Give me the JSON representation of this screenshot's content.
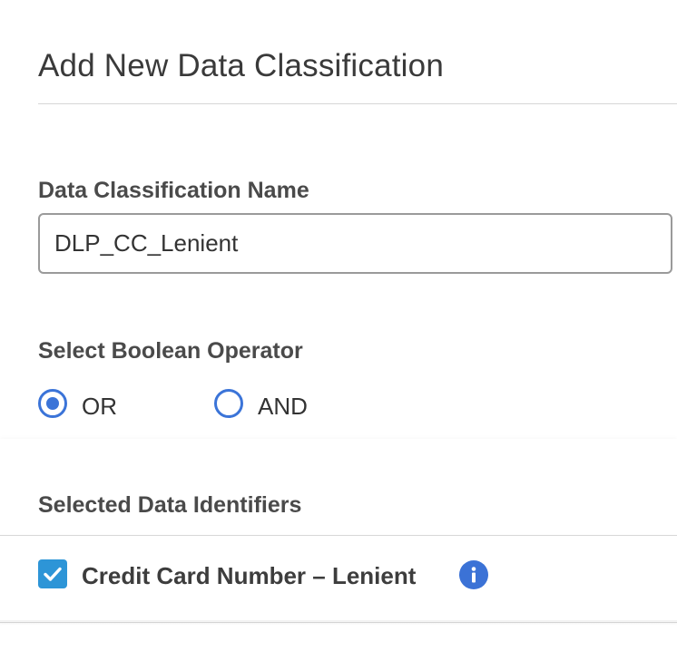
{
  "dialog": {
    "title": "Add New Data Classification"
  },
  "name_field": {
    "label": "Data Classification Name",
    "value": "DLP_CC_Lenient"
  },
  "boolean_operator": {
    "label": "Select Boolean Operator",
    "options": [
      {
        "label": "OR",
        "selected": true
      },
      {
        "label": "AND",
        "selected": false
      }
    ]
  },
  "identifiers": {
    "label": "Selected Data Identifiers",
    "items": [
      {
        "label": "Credit Card Number – Lenient",
        "checked": true,
        "info_icon": "info-icon"
      }
    ]
  },
  "colors": {
    "accent_blue": "#3b74d8",
    "checkbox_blue": "#2d95d7",
    "text": "#333333"
  }
}
